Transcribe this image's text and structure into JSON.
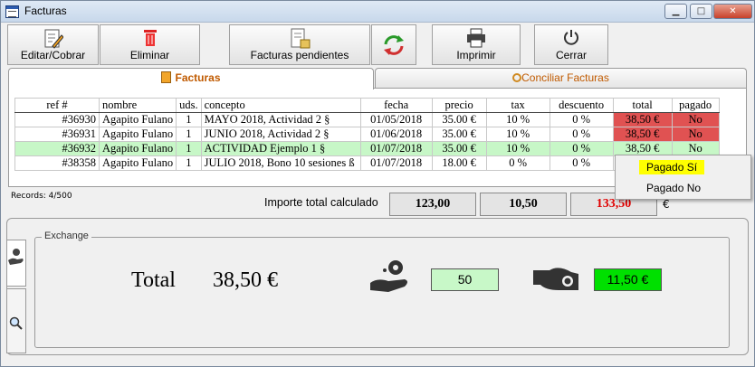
{
  "window": {
    "title": "Facturas",
    "min_glyph": "▁",
    "max_glyph": "□",
    "close_glyph": "✕"
  },
  "toolbar": {
    "edit_label": "Editar/Cobrar",
    "delete_label": "Eliminar",
    "pending_label": "Facturas pendientes",
    "print_label": "Imprimir",
    "close_label": "Cerrar"
  },
  "tabs": {
    "facturas": "Facturas",
    "conciliar": "Conciliar Facturas"
  },
  "table": {
    "headers": [
      "ref #",
      "nombre",
      "uds.",
      "concepto",
      "fecha",
      "precio",
      "tax",
      "descuento",
      "total",
      "pagado"
    ],
    "rows": [
      [
        "#36930",
        "Agapito Fulano",
        "1",
        "MAYO 2018, Actividad 2 §",
        "01/05/2018",
        "35.00 €",
        "10 %",
        "0 %",
        "38,50 €",
        "No"
      ],
      [
        "#36931",
        "Agapito Fulano",
        "1",
        "JUNIO 2018, Actividad 2 §",
        "01/06/2018",
        "35.00 €",
        "10 %",
        "0 %",
        "38,50 €",
        "No"
      ],
      [
        "#36932",
        "Agapito Fulano",
        "1",
        "ACTIVIDAD Ejemplo 1 §",
        "01/07/2018",
        "35.00 €",
        "10 %",
        "0 %",
        "38,50 €",
        "No"
      ],
      [
        "#38358",
        "Agapito Fulano",
        "1",
        "JULIO 2018, Bono 10 sesiones ß",
        "01/07/2018",
        "18.00 €",
        "0 %",
        "0 %",
        "",
        ""
      ]
    ]
  },
  "context_menu": {
    "items": [
      "Pagado Sí",
      "Pagado No"
    ]
  },
  "summary": {
    "records": "Records: 4/500",
    "importe_label": "Importe total calculado",
    "total": "123,00",
    "tax": "10,50",
    "pending": "133,50",
    "currency": "€"
  },
  "exchange": {
    "legend": "Exchange",
    "total_label": "Total",
    "total_value": "38,50 €",
    "received": "50",
    "change": "11,50 €"
  },
  "colors": {
    "unpaid_red": "#e05252",
    "selected_green": "#c7f7c7",
    "change_green": "#00e000",
    "received_green": "#c8f8c8",
    "pending_red": "#e00000"
  }
}
